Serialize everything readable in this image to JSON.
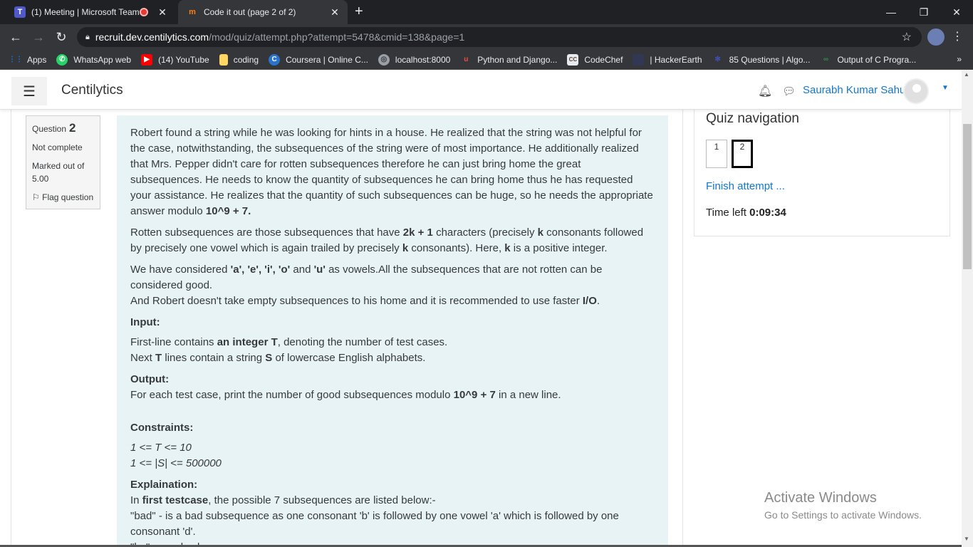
{
  "browser": {
    "tabs": [
      {
        "title": "(1) Meeting | Microsoft Teams",
        "icon": "teams-icon",
        "recording": true
      },
      {
        "title": "Code it out (page 2 of 2)",
        "icon": "moodle-icon",
        "active": true
      }
    ],
    "url_host": "recruit.dev.centilytics.com",
    "url_path": "/mod/quiz/attempt.php?attempt=5478&cmid=138&page=1",
    "bookmarks": [
      {
        "label": "Apps",
        "icon": "apps-grid-icon",
        "color": "#1a73e8"
      },
      {
        "label": "WhatsApp web",
        "icon": "whatsapp-icon",
        "color": "#25d366"
      },
      {
        "label": "(14) YouTube",
        "icon": "youtube-icon",
        "color": "#ff0000"
      },
      {
        "label": "coding",
        "icon": "folder-icon",
        "color": "#fdd663"
      },
      {
        "label": "Coursera | Online C...",
        "icon": "coursera-icon",
        "color": "#2a73cc"
      },
      {
        "label": "localhost:8000",
        "icon": "globe-icon",
        "color": "#9aa0a6"
      },
      {
        "label": "Python and Django...",
        "icon": "udemy-icon",
        "color": "#e8523f"
      },
      {
        "label": "CodeChef",
        "icon": "codechef-icon",
        "color": "#5b4638"
      },
      {
        "label": "| HackerEarth",
        "icon": "hackerearth-icon",
        "color": "#323754"
      },
      {
        "label": "85 Questions | Algo...",
        "icon": "algo-icon",
        "color": "#3f51b5"
      },
      {
        "label": "Output of C Progra...",
        "icon": "gfg-icon",
        "color": "#2f8d46"
      }
    ],
    "more_bookmarks": "»"
  },
  "navbar": {
    "brand": "Centilytics",
    "user_name": "Saurabh Kumar Sahu"
  },
  "question_info": {
    "label": "Question",
    "number": "2",
    "state": "Not complete",
    "marked_out_of": "Marked out of",
    "marks": "5.00",
    "flag_label": "Flag question"
  },
  "question": {
    "p1": "Robert found a string while he was looking for hints in a house. He realized that the string was not helpful for the case, notwithstanding, the subsequences of the string were of most importance. He additionally realized that Mrs. Pepper didn't care for rotten subsequences therefore he can just bring home the great subsequences. He needs to know the quantity of subsequences he can bring home thus he has requested your assistance. He realizes that the quantity of such subsequences can be huge, so he needs the appropriate answer modulo",
    "p1_mod": "10^9 + 7.",
    "p2_a": "Rotten subsequences are those subsequences that have",
    "p2_b": "2k + 1",
    "p2_c": "characters (precisely",
    "p2_d": "k",
    "p2_e": "consonants followed by precisely one vowel which is again trailed by precisely",
    "p2_f": "k",
    "p2_g": "consonants). Here,",
    "p2_h": "k",
    "p2_i": "is a positive integer.",
    "p3_a": "We have considered",
    "p3_vowels": "'a', 'e', 'i', 'o'",
    "p3_and": "and",
    "p3_u": "'u'",
    "p3_b": "as vowels.All the subsequences that are not rotten can be considered good.",
    "p3_c": "And Robert doesn't take empty subsequences to his home and it is recommended to use faster",
    "p3_io": "I/O",
    "p3_dot": ".",
    "input_h": "Input:",
    "input_1a": "First-line contains",
    "input_1b": "an integer T",
    "input_1c": ", denoting the number of test cases.",
    "input_2a": "Next",
    "input_2b": "T",
    "input_2c": "lines contain a string",
    "input_2d": "S",
    "input_2e": "of lowercase English alphabets.",
    "output_h": "Output:",
    "output_a": "For each test case, print the number of good subsequences modulo",
    "output_b": "10^9 + 7",
    "output_c": "in a new line.",
    "constraints_h": "Constraints:",
    "c1": "1 <= T <= 10",
    "c2": "1 <= |S| <= 500000",
    "explain_h": "Explaination:",
    "ex_a": "In",
    "ex_b": "first testcase",
    "ex_c": ", the possible 7 subsequences are listed below:-",
    "ex_2": "\"bad\" - is a bad subsequence as one consonant 'b' is followed by one vowel 'a' which is followed by one consonant 'd'.",
    "ex_3": "\"ba\" - good subsequence"
  },
  "quiz_nav": {
    "title": "Quiz navigation",
    "buttons": [
      "1",
      "2"
    ],
    "finish": "Finish attempt ...",
    "time_label": "Time left",
    "time_value": "0:09:34"
  },
  "watermark": {
    "line1": "Activate Windows",
    "line2": "Go to Settings to activate Windows."
  }
}
